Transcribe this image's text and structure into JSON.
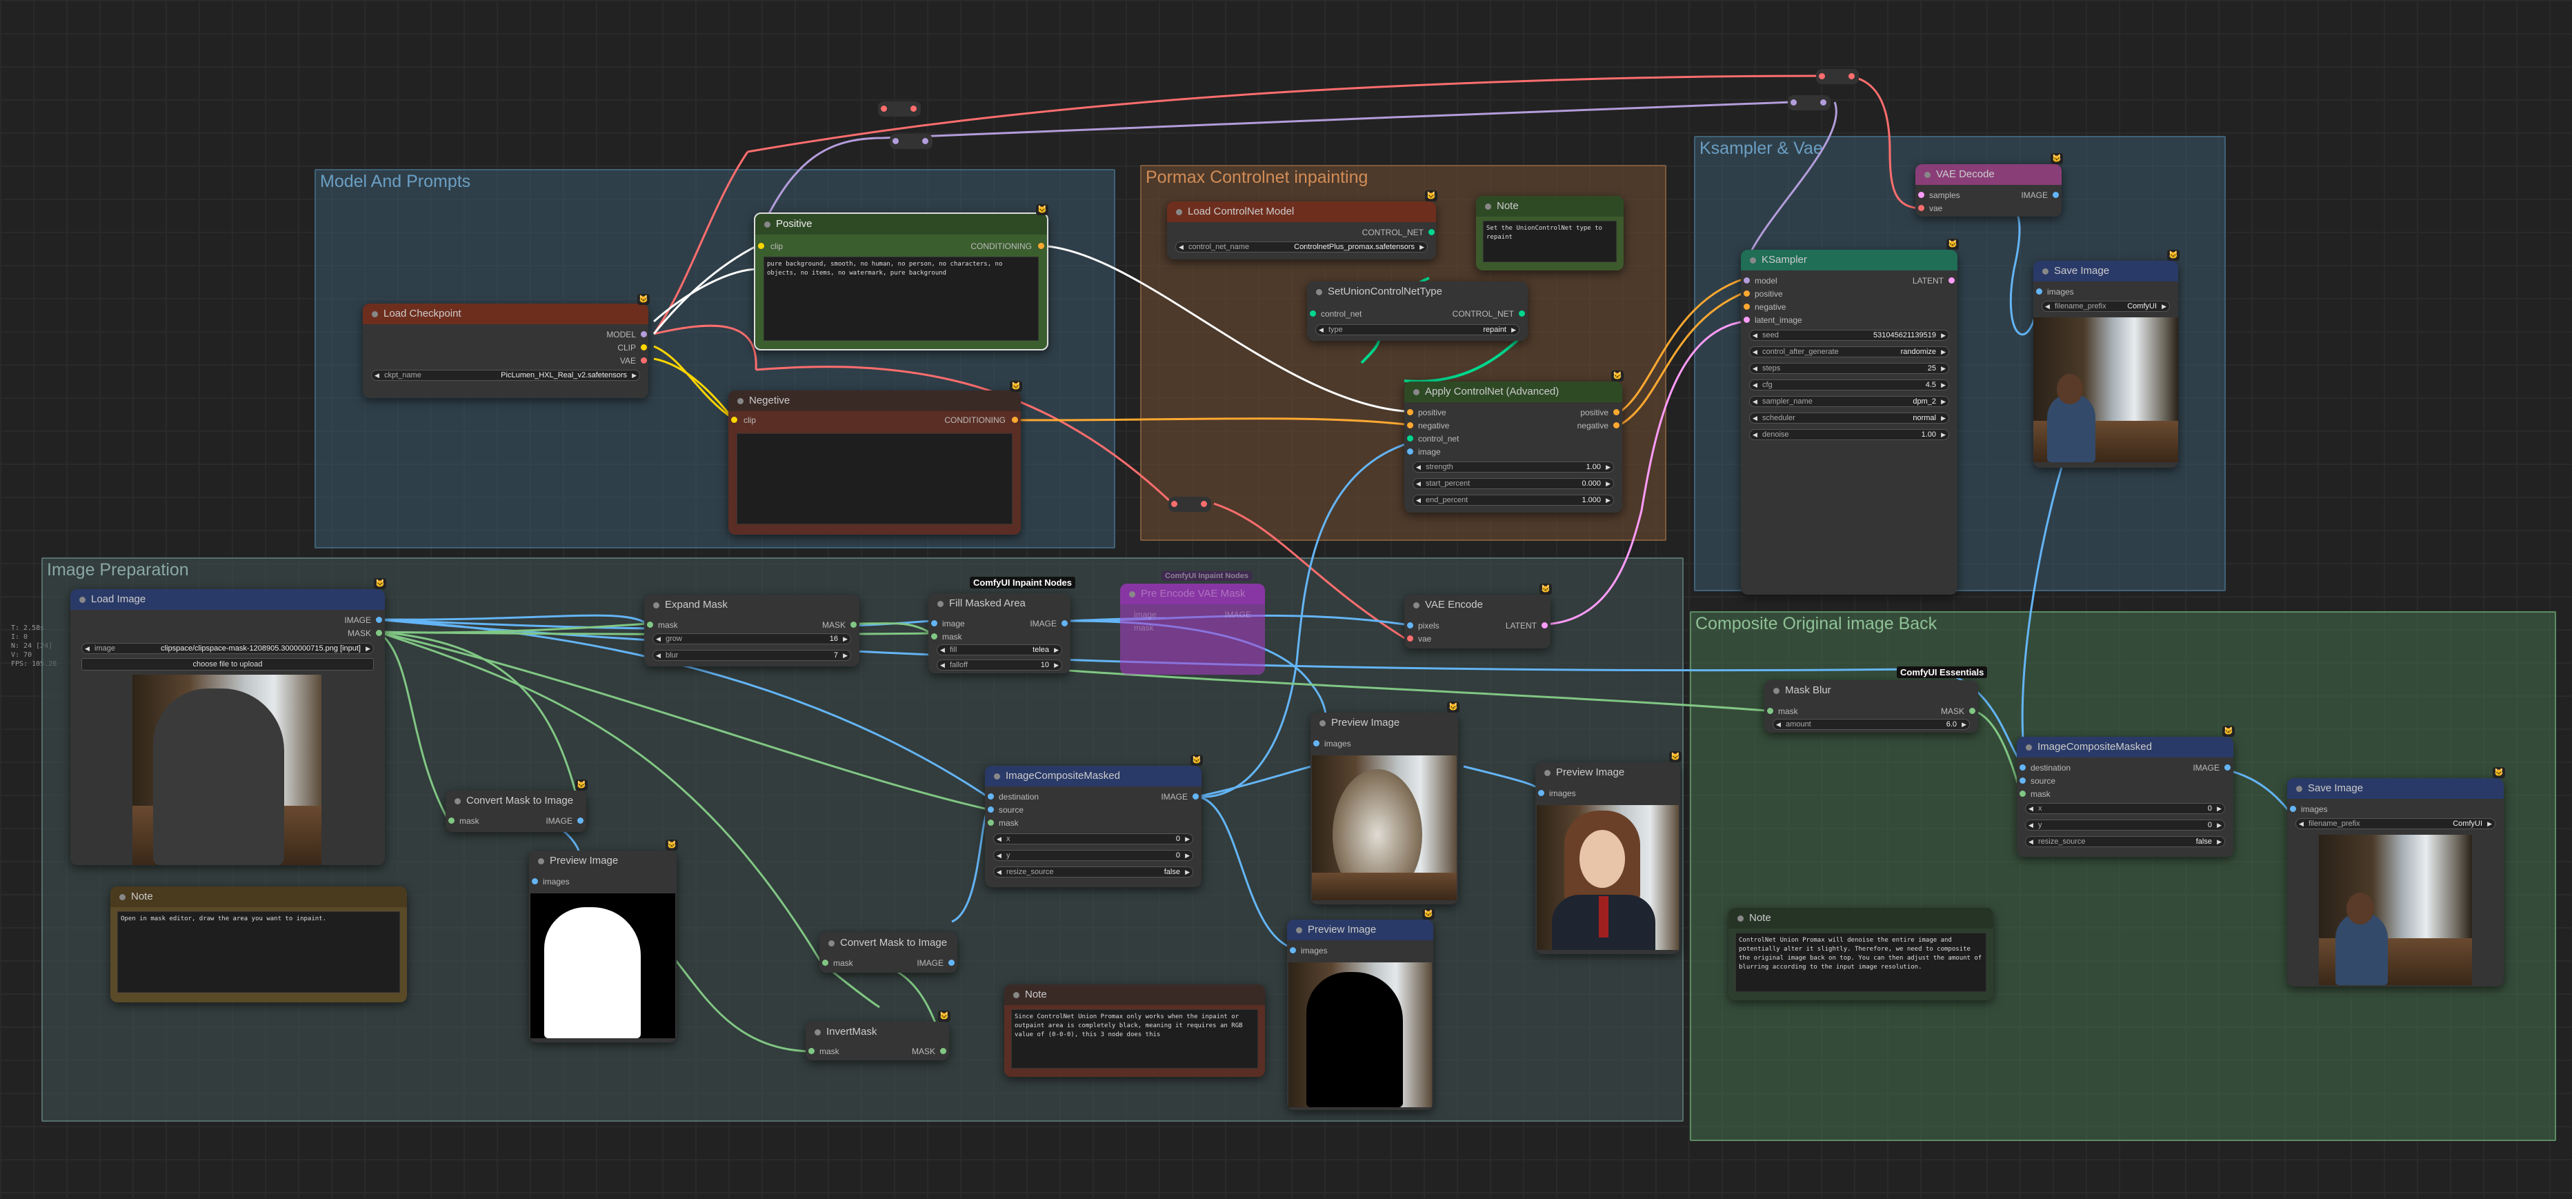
{
  "groups": {
    "model_prompts": "Model And Prompts",
    "controlnet": "Pormax Controlnet inpainting",
    "ksampler_vae": "Ksampler & Vae",
    "image_prep": "Image Preparation",
    "composite": "Composite Original image Back"
  },
  "stats": [
    "T: 2.58s",
    "I: 0",
    "N: 24 [24]",
    "V: 70",
    "FPS: 105.26"
  ],
  "nodes": {
    "load_checkpoint": {
      "title": "Load Checkpoint",
      "out_model": "MODEL",
      "out_clip": "CLIP",
      "out_vae": "VAE",
      "ckpt_label": "ckpt_name",
      "ckpt_value": "PicLumen_HXL_Real_v2.safetensors"
    },
    "positive": {
      "title": "Positive",
      "in_clip": "clip",
      "out": "CONDITIONING",
      "text": "pure background, smooth, no human, no person, no characters, no objects, no items, no watermark, pure background"
    },
    "negative": {
      "title": "Negetive",
      "in_clip": "clip",
      "out": "CONDITIONING",
      "text": ""
    },
    "load_controlnet": {
      "title": "Load ControlNet Model",
      "out": "CONTROL_NET",
      "label": "control_net_name",
      "value": "ControlnetPlus_promax.safetensors"
    },
    "note_cn": {
      "title": "Note",
      "text": "Set the UnionControlNet type to repaint"
    },
    "set_union": {
      "title": "SetUnionControlNetType",
      "in": "control_net",
      "out": "CONTROL_NET",
      "label": "type",
      "value": "repaint"
    },
    "apply_cn": {
      "title": "Apply ControlNet (Advanced)",
      "in_pos": "positive",
      "in_neg": "negative",
      "in_cn": "control_net",
      "in_img": "image",
      "out_pos": "positive",
      "out_neg": "negative",
      "w": [
        {
          "l": "strength",
          "v": "1.00"
        },
        {
          "l": "start_percent",
          "v": "0.000"
        },
        {
          "l": "end_percent",
          "v": "1.000"
        }
      ]
    },
    "ksampler": {
      "title": "KSampler",
      "ins": [
        "model",
        "positive",
        "negative",
        "latent_image"
      ],
      "out": "LATENT",
      "w": [
        {
          "l": "seed",
          "v": "531045621139519"
        },
        {
          "l": "control_after_generate",
          "v": "randomize"
        },
        {
          "l": "steps",
          "v": "25"
        },
        {
          "l": "cfg",
          "v": "4.5"
        },
        {
          "l": "sampler_name",
          "v": "dpm_2"
        },
        {
          "l": "scheduler",
          "v": "normal"
        },
        {
          "l": "denoise",
          "v": "1.00"
        }
      ]
    },
    "vae_decode": {
      "title": "VAE Decode",
      "in_samples": "samples",
      "in_vae": "vae",
      "out": "IMAGE"
    },
    "save_top": {
      "title": "Save Image",
      "in": "images",
      "label": "filename_prefix",
      "value": "ComfyUI"
    },
    "load_image": {
      "title": "Load Image",
      "out_image": "IMAGE",
      "out_mask": "MASK",
      "label": "image",
      "value": "clipspace/clipspace-mask-1208905.3000000715.png [input]",
      "upload": "choose file to upload"
    },
    "expand_mask": {
      "title": "Expand Mask",
      "in": "mask",
      "out": "MASK",
      "w": [
        {
          "l": "grow",
          "v": "16"
        },
        {
          "l": "blur",
          "v": "7"
        }
      ]
    },
    "fill_masked": {
      "title": "Fill Masked Area",
      "tag": "ComfyUI Inpaint Nodes",
      "in_image": "image",
      "in_mask": "mask",
      "out": "IMAGE",
      "w": [
        {
          "l": "fill",
          "v": "telea"
        },
        {
          "l": "falloff",
          "v": "10"
        }
      ]
    },
    "bypassed": {
      "tag": "ComfyUI Inpaint Nodes",
      "title": "Pre Encode VAE Mask",
      "a": "image",
      "b": "mask",
      "c": "IMAGE"
    },
    "vae_encode": {
      "title": "VAE Encode",
      "in_pixels": "pixels",
      "in_vae": "vae",
      "out": "LATENT"
    },
    "convert1": {
      "title": "Convert Mask to Image",
      "in": "mask",
      "out": "IMAGE"
    },
    "preview1": {
      "title": "Preview Image",
      "in": "images"
    },
    "note_img": {
      "title": "Note",
      "text": "Open in mask editor, draw the area you want to inpaint."
    },
    "composite1": {
      "title": "ImageCompositeMasked",
      "ins": [
        "destination",
        "source",
        "mask"
      ],
      "out": "IMAGE",
      "w": [
        {
          "l": "x",
          "v": "0"
        },
        {
          "l": "y",
          "v": "0"
        },
        {
          "l": "resize_source",
          "v": "false"
        }
      ]
    },
    "convert2": {
      "title": "Convert Mask to Image",
      "in": "mask",
      "out": "IMAGE"
    },
    "invert": {
      "title": "InvertMask",
      "in": "mask",
      "out": "MASK"
    },
    "note_mid": {
      "title": "Note",
      "text": "Since ControlNet Union Promax only works when the inpaint or outpaint area is completely black, meaning it requires an RGB value of (0-0-0), this 3 node does this"
    },
    "preview2": {
      "title": "Preview Image",
      "in": "images"
    },
    "preview3": {
      "title": "Preview Image",
      "in": "images"
    },
    "preview4": {
      "title": "Preview Image",
      "in": "images"
    },
    "mask_blur": {
      "title": "Mask Blur",
      "tag": "ComfyUI Essentials",
      "in": "mask",
      "out": "MASK",
      "label": "amount",
      "value": "6.0"
    },
    "composite2": {
      "title": "ImageCompositeMasked",
      "ins": [
        "destination",
        "source",
        "mask"
      ],
      "out": "IMAGE",
      "w": [
        {
          "l": "x",
          "v": "0"
        },
        {
          "l": "y",
          "v": "0"
        },
        {
          "l": "resize_source",
          "v": "false"
        }
      ]
    },
    "save_bottom": {
      "title": "Save Image",
      "in": "images",
      "label": "filename_prefix",
      "value": "ComfyUI"
    },
    "note_comp": {
      "title": "Note",
      "text": "ControlNet Union Promax will denoise the entire image and potentially alter it slightly. Therefore, we need to composite the original image back on top. You can then adjust the amount of blurring according to the input image resolution."
    }
  },
  "colors": {
    "clip": "#ffd500",
    "model": "#b39ddb",
    "vae": "#ff6e6e",
    "cond": "#ffa931",
    "image": "#64b5f6",
    "mask": "#81c784",
    "latent": "#ff9cf9",
    "cnet": "#00d78d"
  }
}
